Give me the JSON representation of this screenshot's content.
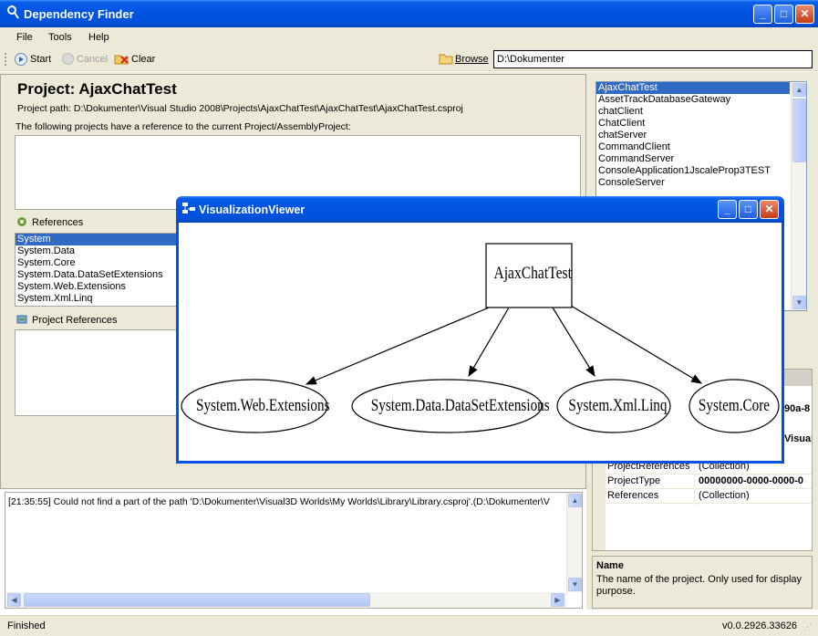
{
  "window": {
    "title": "Dependency Finder"
  },
  "menu": [
    "File",
    "Tools",
    "Help"
  ],
  "toolbar": {
    "start": "Start",
    "cancel": "Cancel",
    "clear": "Clear",
    "browse": "Browse",
    "path_value": "D:\\Dokumenter"
  },
  "project": {
    "title": "Project: AjaxChatTest",
    "path_line": "Project path: D:\\Dokumenter\\Visual Studio 2008\\Projects\\AjaxChatTest\\AjaxChatTest\\AjaxChatTest.csproj",
    "ref_note": "The following projects have a reference to the current Project/AssemblyProject:",
    "references_label": "References",
    "references": [
      "System",
      "System.Data",
      "System.Core",
      "System.Data.DataSetExtensions",
      "System.Web.Extensions",
      "System.Xml.Linq"
    ],
    "project_references_label": "Project References"
  },
  "project_list": [
    "AjaxChatTest",
    "AssetTrackDatabaseGateway",
    "chatClient",
    "ChatClient",
    "chatServer",
    "CommandClient",
    "CommandServer",
    "ConsoleApplication1JscaleProp3TEST",
    "ConsoleServer"
  ],
  "properties": {
    "partial_values": [
      "90a-8",
      "Visual"
    ],
    "rows": [
      {
        "name": "ProjectReferences",
        "value": "(Collection)"
      },
      {
        "name": "ProjectType",
        "value": "00000000-0000-0000-0"
      },
      {
        "name": "References",
        "value": "(Collection)"
      }
    ],
    "desc_title": "Name",
    "desc_text": "The name of the project. Only used for display purpose."
  },
  "log": {
    "line": "[21:35:55] Could not find a part of the path 'D:\\Dokumenter\\Visual3D Worlds\\My Worlds\\Library\\Library.csproj'.(D:\\Dokumenter\\V"
  },
  "status": {
    "left": "Finished",
    "right": "v0.0.2926.33626"
  },
  "viewer": {
    "title": "VisualizationViewer",
    "root": "AjaxChatTest",
    "nodes": [
      "System.Web.Extensions",
      "System.Data.DataSetExtensions",
      "System.Xml.Linq",
      "System.Core"
    ]
  },
  "colors": {
    "xp_blue": "#0054e3",
    "selection": "#316ac5",
    "control": "#ece9d8"
  }
}
